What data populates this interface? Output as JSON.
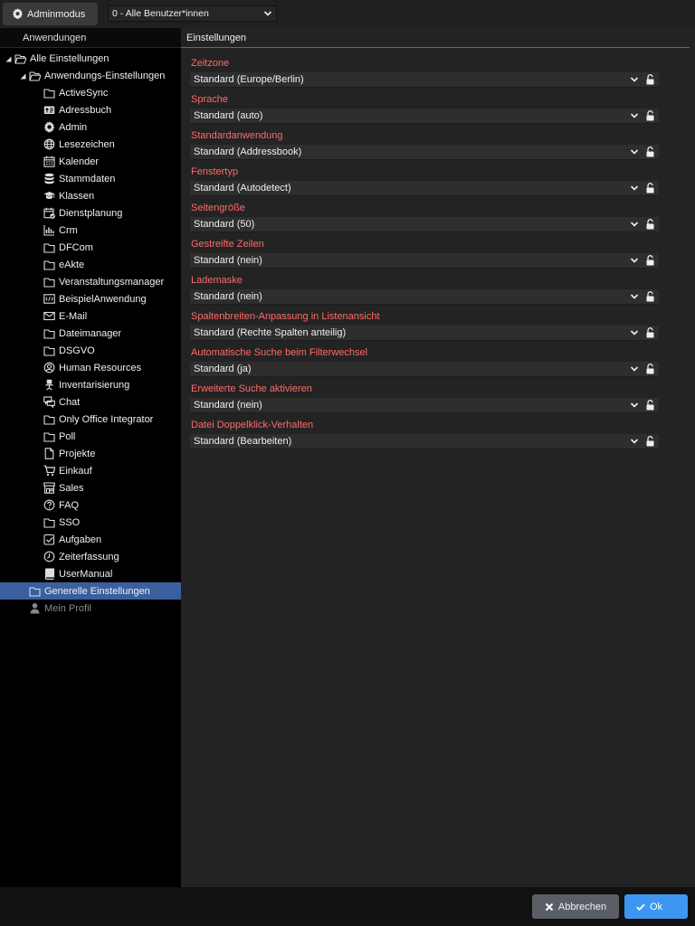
{
  "toolbar": {
    "admin_label": "Adminmodus",
    "user_select_value": "0 - Alle Benutzer*innen"
  },
  "left_panel": {
    "header": "Anwendungen",
    "tree": [
      {
        "label": "Alle Einstellungen",
        "icon": "folder-open-icon",
        "level": 0,
        "expanded": true
      },
      {
        "label": "Anwendungs-Einstellungen",
        "icon": "folder-open-icon",
        "level": 1,
        "expanded": true
      },
      {
        "label": "ActiveSync",
        "icon": "folder-icon",
        "level": 2
      },
      {
        "label": "Adressbuch",
        "icon": "address-card-icon",
        "level": 2
      },
      {
        "label": "Admin",
        "icon": "gear-icon",
        "level": 2
      },
      {
        "label": "Lesezeichen",
        "icon": "globe-icon",
        "level": 2
      },
      {
        "label": "Kalender",
        "icon": "calendar-icon",
        "level": 2
      },
      {
        "label": "Stammdaten",
        "icon": "database-icon",
        "level": 2
      },
      {
        "label": "Klassen",
        "icon": "graduation-cap-icon",
        "level": 2
      },
      {
        "label": "Dienstplanung",
        "icon": "calendar-check-icon",
        "level": 2
      },
      {
        "label": "Crm",
        "icon": "bar-chart-icon",
        "level": 2
      },
      {
        "label": "DFCom",
        "icon": "folder-icon",
        "level": 2
      },
      {
        "label": "eAkte",
        "icon": "folder-icon",
        "level": 2
      },
      {
        "label": "Veranstaltungsmanager",
        "icon": "folder-icon",
        "level": 2
      },
      {
        "label": "BeispielAnwendung",
        "icon": "code-icon",
        "level": 2
      },
      {
        "label": "E-Mail",
        "icon": "envelope-icon",
        "level": 2
      },
      {
        "label": "Dateimanager",
        "icon": "folder-icon",
        "level": 2
      },
      {
        "label": "DSGVO",
        "icon": "folder-icon",
        "level": 2
      },
      {
        "label": "Human Resources",
        "icon": "user-circle-icon",
        "level": 2
      },
      {
        "label": "Inventarisierung",
        "icon": "chair-icon",
        "level": 2
      },
      {
        "label": "Chat",
        "icon": "comments-icon",
        "level": 2
      },
      {
        "label": "Only Office Integrator",
        "icon": "folder-icon",
        "level": 2
      },
      {
        "label": "Poll",
        "icon": "folder-icon",
        "level": 2
      },
      {
        "label": "Projekte",
        "icon": "file-icon",
        "level": 2
      },
      {
        "label": "Einkauf",
        "icon": "cart-icon",
        "level": 2
      },
      {
        "label": "Sales",
        "icon": "store-icon",
        "level": 2
      },
      {
        "label": "FAQ",
        "icon": "question-circle-icon",
        "level": 2
      },
      {
        "label": "SSO",
        "icon": "folder-icon",
        "level": 2
      },
      {
        "label": "Aufgaben",
        "icon": "check-square-icon",
        "level": 2
      },
      {
        "label": "Zeiterfassung",
        "icon": "clock-icon",
        "level": 2
      },
      {
        "label": "UserManual",
        "icon": "book-icon",
        "level": 2
      },
      {
        "label": "Generelle Einstellungen",
        "icon": "folder-icon",
        "level": 1,
        "selected": true
      },
      {
        "label": "Mein Profil",
        "icon": "user-icon",
        "level": 1,
        "muted": true
      }
    ]
  },
  "right_panel": {
    "header": "Einstellungen",
    "settings": [
      {
        "label": "Zeitzone",
        "value": "Standard (Europe/Berlin)"
      },
      {
        "label": "Sprache",
        "value": "Standard (auto)"
      },
      {
        "label": "Standardanwendung",
        "value": "Standard (Addressbook)"
      },
      {
        "label": "Fenstertyp",
        "value": "Standard (Autodetect)"
      },
      {
        "label": "Seitengröße",
        "value": "Standard (50)"
      },
      {
        "label": "Gestreifte Zeilen",
        "value": "Standard (nein)"
      },
      {
        "label": "Lademaske",
        "value": "Standard (nein)"
      },
      {
        "label": "Spaltenbreiten-Anpassung in Listenansicht",
        "value": "Standard (Rechte Spalten anteilig)"
      },
      {
        "label": "Automatische Suche beim Filterwechsel",
        "value": "Standard (ja)"
      },
      {
        "label": "Erweiterte Suche aktivieren",
        "value": "Standard (nein)"
      },
      {
        "label": "Datei Doppelklick-Verhalten",
        "value": "Standard (Bearbeiten)"
      }
    ]
  },
  "footer": {
    "cancel_label": "Abbrechen",
    "ok_label": "Ok"
  },
  "colors": {
    "accent": "#3d97f0",
    "selected_row": "#3a5f9e",
    "label_red": "#ff6a6a"
  }
}
